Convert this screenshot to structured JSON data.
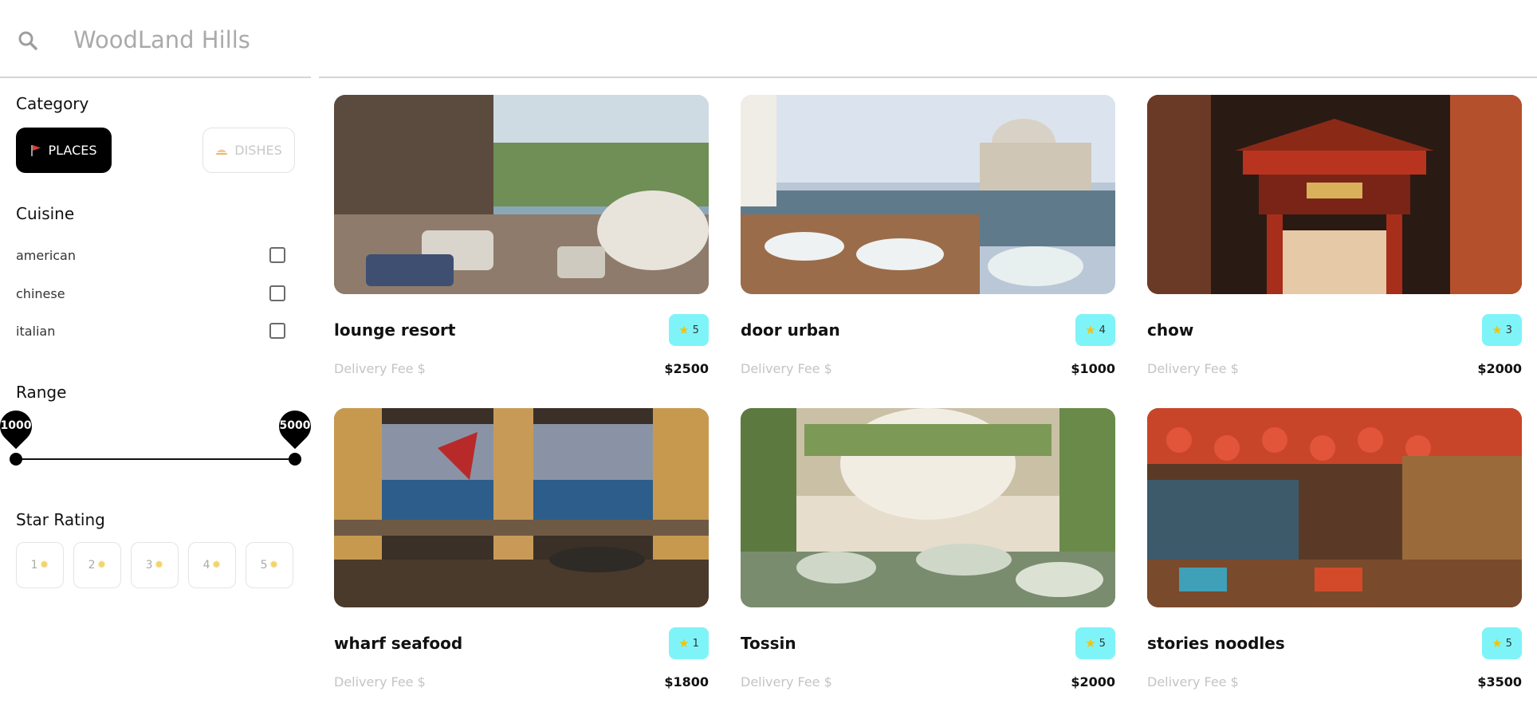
{
  "search": {
    "placeholder": "WoodLand Hills",
    "value": ""
  },
  "sidebar": {
    "category_title": "Category",
    "categories": [
      {
        "label": "PLACES",
        "icon": "flag-icon",
        "selected": true
      },
      {
        "label": "DISHES",
        "icon": "dish-icon",
        "selected": false
      }
    ],
    "cuisine_title": "Cuisine",
    "cuisines": [
      {
        "label": "american",
        "checked": false
      },
      {
        "label": "chinese",
        "checked": false
      },
      {
        "label": "italian",
        "checked": false
      }
    ],
    "range_title": "Range",
    "range": {
      "min": "1000",
      "max": "5000"
    },
    "rating_title": "Star Rating",
    "ratings": [
      "1",
      "2",
      "3",
      "4",
      "5"
    ]
  },
  "cards": [
    {
      "name": "lounge resort",
      "rating": "5",
      "fee_label": "Delivery Fee $",
      "price": "$2500"
    },
    {
      "name": "door urban",
      "rating": "4",
      "fee_label": "Delivery Fee $",
      "price": "$1000"
    },
    {
      "name": "chow",
      "rating": "3",
      "fee_label": "Delivery Fee $",
      "price": "$2000"
    },
    {
      "name": "wharf seafood",
      "rating": "1",
      "fee_label": "Delivery Fee $",
      "price": "$1800"
    },
    {
      "name": "Tossin",
      "rating": "5",
      "fee_label": "Delivery Fee $",
      "price": "$2000"
    },
    {
      "name": "stories noodles",
      "rating": "5",
      "fee_label": "Delivery Fee $",
      "price": "$3500"
    }
  ],
  "colors": {
    "accent": "#000000",
    "badge": "#7ef4f8",
    "star": "#f4c20d",
    "muted": "#c4c4c4"
  }
}
